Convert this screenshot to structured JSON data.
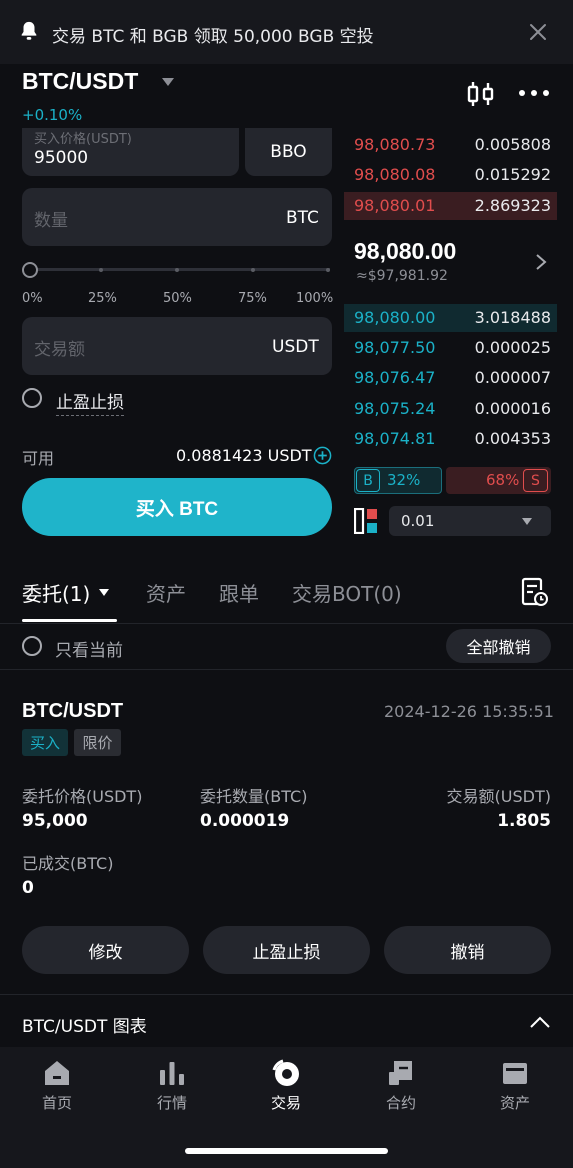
{
  "notification": {
    "text": "交易 BTC 和 BGB 领取 50,000 BGB 空投",
    "icon": "bell-icon",
    "close_icon": "close-icon"
  },
  "header": {
    "pair": "BTC/USDT",
    "change": "+0.10%"
  },
  "form": {
    "price_label": "买入价格(USDT)",
    "price_value": "95000",
    "bbo_label": "BBO",
    "quantity_placeholder": "数量",
    "quantity_unit": "BTC",
    "slider_marks": [
      "0%",
      "25%",
      "50%",
      "75%",
      "100%"
    ],
    "slider_value": 0,
    "amount_placeholder": "交易额",
    "amount_unit": "USDT",
    "tpsl_label": "止盈止损",
    "available_label": "可用",
    "available_value": "0.0881423 USDT",
    "buy_button": "买入 BTC"
  },
  "orderbook": {
    "asks": [
      {
        "price": "98,080.73",
        "qty": "0.005808"
      },
      {
        "price": "98,080.08",
        "qty": "0.015292"
      },
      {
        "price": "98,080.01",
        "qty": "2.869323"
      }
    ],
    "last_price": "98,080.00",
    "last_price_usd": "≈$97,981.92",
    "bids": [
      {
        "price": "98,080.00",
        "qty": "3.018488"
      },
      {
        "price": "98,077.50",
        "qty": "0.000025"
      },
      {
        "price": "98,076.47",
        "qty": "0.000007"
      },
      {
        "price": "98,075.24",
        "qty": "0.000016"
      },
      {
        "price": "98,074.81",
        "qty": "0.004353"
      }
    ],
    "buy_badge": "B",
    "buy_ratio": "32%",
    "sell_ratio": "68%",
    "sell_badge": "S",
    "depth_value": "0.01"
  },
  "tabs": [
    {
      "label": "委托(1)"
    },
    {
      "label": "资产"
    },
    {
      "label": "跟单"
    },
    {
      "label": "交易BOT(0)"
    }
  ],
  "filter": {
    "only_current_label": "只看当前",
    "cancel_all_label": "全部撤销"
  },
  "order": {
    "pair": "BTC/USDT",
    "time": "2024-12-26 15:35:51",
    "side_tag": "买入",
    "type_tag": "限价",
    "price_label": "委托价格(USDT)",
    "price_value": "95,000",
    "qty_label": "委托数量(BTC)",
    "qty_value": "0.000019",
    "amount_label": "交易额(USDT)",
    "amount_value": "1.805",
    "filled_label": "已成交(BTC)",
    "filled_value": "0",
    "buttons": [
      "修改",
      "止盈止损",
      "撤销"
    ]
  },
  "chart_section": {
    "label": "BTC/USDT 图表"
  },
  "nav": [
    {
      "label": "首页",
      "icon": "home-icon"
    },
    {
      "label": "行情",
      "icon": "markets-icon"
    },
    {
      "label": "交易",
      "icon": "trade-icon"
    },
    {
      "label": "合约",
      "icon": "futures-icon"
    },
    {
      "label": "资产",
      "icon": "wallet-icon"
    }
  ],
  "colors": {
    "accent": "#1fb4ca",
    "bid": "#1bb1c7",
    "ask": "#e04d4d",
    "background": "#0e0f13"
  }
}
